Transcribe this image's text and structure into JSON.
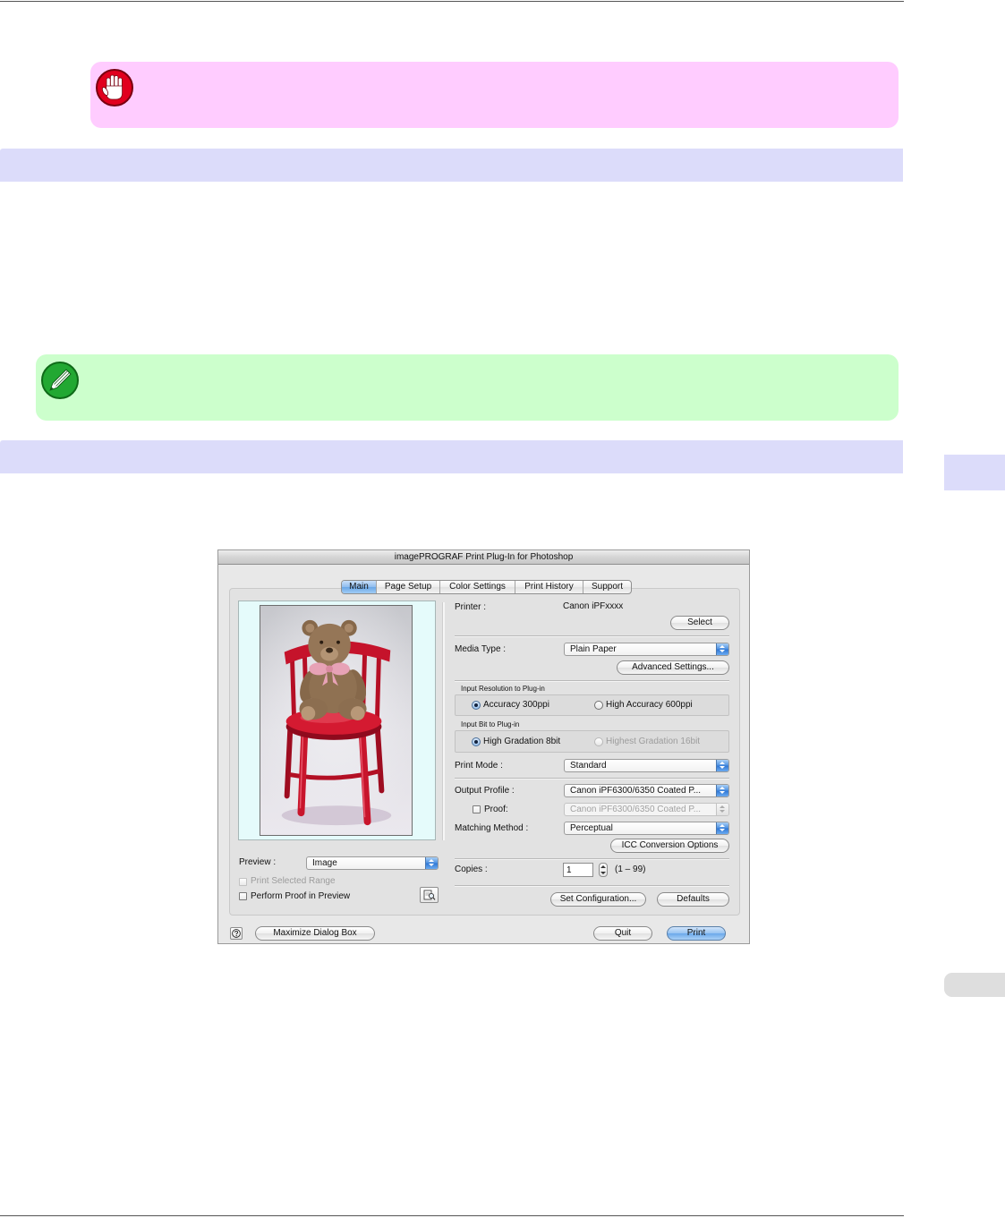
{
  "colors": {
    "rule": "#555555",
    "important_bg": "#ffccff",
    "important_icon": "#e1001e",
    "note_bg": "#ccffcc",
    "note_icon": "#22a832",
    "section_bar": "#dcdcfa",
    "side_tab_chapter": "#dcdcfa",
    "side_tab_other": "#dedede",
    "selected_blue": "#6aa6e6"
  },
  "icons": {
    "important": "hand-stop-icon",
    "note": "pencil-icon",
    "help": "question-mark-icon",
    "proof_preview": "proof-preview-icon",
    "popup_stepper": "up-down-arrows-icon"
  },
  "dialog": {
    "title": "imagePROGRAF Print Plug-In for Photoshop",
    "tabs": [
      {
        "label": "Main",
        "selected": true
      },
      {
        "label": "Page Setup",
        "selected": false
      },
      {
        "label": "Color Settings",
        "selected": false
      },
      {
        "label": "Print History",
        "selected": false
      },
      {
        "label": "Support",
        "selected": false
      }
    ],
    "preview": {
      "label": "Preview :",
      "value": "Image",
      "print_selected_range": {
        "label": "Print Selected Range",
        "checked": false,
        "disabled": true
      },
      "perform_proof": {
        "label": "Perform Proof in Preview",
        "checked": false,
        "disabled": false
      }
    },
    "printer": {
      "label": "Printer :",
      "value": "Canon iPFxxxx",
      "select_button": "Select"
    },
    "media_type": {
      "label": "Media Type :",
      "value": "Plain Paper",
      "advanced_button": "Advanced Settings..."
    },
    "input_resolution": {
      "label": "Input Resolution to Plug-in",
      "options": [
        {
          "label": "Accuracy 300ppi",
          "checked": true,
          "disabled": false
        },
        {
          "label": "High Accuracy 600ppi",
          "checked": false,
          "disabled": false
        }
      ]
    },
    "input_bit": {
      "label": "Input Bit to Plug-in",
      "options": [
        {
          "label": "High Gradation 8bit",
          "checked": true,
          "disabled": false
        },
        {
          "label": "Highest Gradation 16bit",
          "checked": false,
          "disabled": true
        }
      ]
    },
    "print_mode": {
      "label": "Print Mode :",
      "value": "Standard"
    },
    "output_profile": {
      "label": "Output Profile :",
      "value": "Canon iPF6300/6350 Coated P..."
    },
    "proof": {
      "label": "Proof:",
      "checked": false,
      "value": "Canon iPF6300/6350 Coated P...",
      "profile_disabled": true
    },
    "matching_method": {
      "label": "Matching Method :",
      "value": "Perceptual",
      "icc_button": "ICC Conversion Options"
    },
    "copies": {
      "label": "Copies :",
      "value": "1",
      "range": "(1 – 99)"
    },
    "set_configuration_button": "Set Configuration...",
    "defaults_button": "Defaults",
    "maximize_button": "Maximize Dialog Box",
    "quit_button": "Quit",
    "print_button": "Print"
  }
}
